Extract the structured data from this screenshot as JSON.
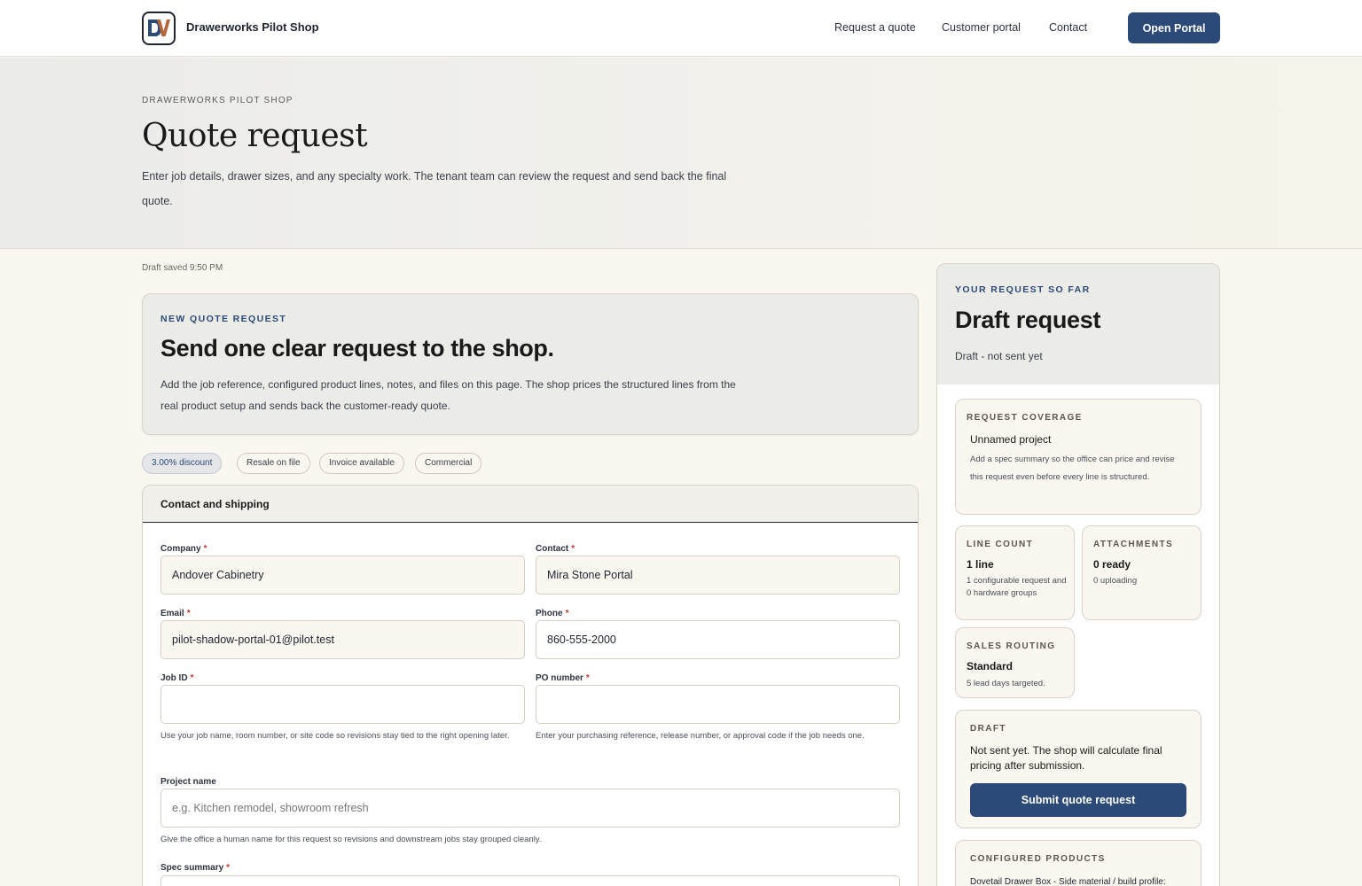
{
  "nav": {
    "brand": "Drawerworks Pilot Shop",
    "links": [
      "Request a quote",
      "Customer portal",
      "Contact"
    ],
    "cta": "Open Portal"
  },
  "hero": {
    "eyebrow": "DRAWERWORKS PILOT SHOP",
    "title": "Quote request",
    "description": "Enter job details, drawer sizes, and any specialty work. The tenant team can review the request and send back the final quote."
  },
  "draft_saved": "Draft saved 9:50 PM",
  "intro": {
    "eyebrow": "NEW QUOTE REQUEST",
    "title": "Send one clear request to the shop.",
    "description": "Add the job reference, configured product lines, notes, and files on this page. The shop prices the structured lines from the real product setup and sends back the customer-ready quote."
  },
  "chips": [
    "3.00% discount",
    "Resale on file",
    "Invoice available",
    "Commercial"
  ],
  "form": {
    "section_title": "Contact and shipping",
    "company": {
      "label": "Company",
      "value": "Andover Cabinetry"
    },
    "contact": {
      "label": "Contact",
      "value": "Mira Stone Portal"
    },
    "email": {
      "label": "Email",
      "value": "pilot-shadow-portal-01@pilot.test"
    },
    "phone": {
      "label": "Phone",
      "value": "860-555-2000"
    },
    "job_id": {
      "label": "Job ID",
      "value": "",
      "help": "Use your job name, room number, or site code so revisions stay tied to the right opening later."
    },
    "po_number": {
      "label": "PO number",
      "value": "",
      "help": "Enter your purchasing reference, release number, or approval code if the job needs one."
    },
    "project_name": {
      "label": "Project name",
      "placeholder": "e.g. Kitchen remodel, showroom refresh",
      "help": "Give the office a human name for this request so revisions and downstream jobs stay grouped cleanly."
    },
    "spec_summary": {
      "label": "Spec summary"
    },
    "required_mark": "*"
  },
  "sidebar": {
    "eyebrow": "YOUR REQUEST SO FAR",
    "title": "Draft request",
    "status": "Draft - not sent yet",
    "coverage": {
      "eyebrow": "REQUEST COVERAGE",
      "value": "Unnamed project",
      "note": "Add a spec summary so the office can price and revise this request even before every line is structured."
    },
    "line_count": {
      "eyebrow": "LINE COUNT",
      "value": "1 line",
      "note": "1 configurable request and 0 hardware groups"
    },
    "attachments": {
      "eyebrow": "ATTACHMENTS",
      "value": "0 ready",
      "note": "0 uploading"
    },
    "sales_routing": {
      "eyebrow": "SALES ROUTING",
      "value": "Standard",
      "note": "5 lead days targeted."
    },
    "draft": {
      "eyebrow": "DRAFT",
      "note": "Not sent yet. The shop will calculate final pricing after submission.",
      "button": "Submit quote request"
    },
    "configured": {
      "eyebrow": "CONFIGURED PRODUCTS",
      "line": "Dovetail Drawer Box - Side material / build profile:"
    }
  },
  "colors": {
    "accent": "#2c4a78",
    "background": "#faf7f0",
    "required": "#c0392b"
  }
}
